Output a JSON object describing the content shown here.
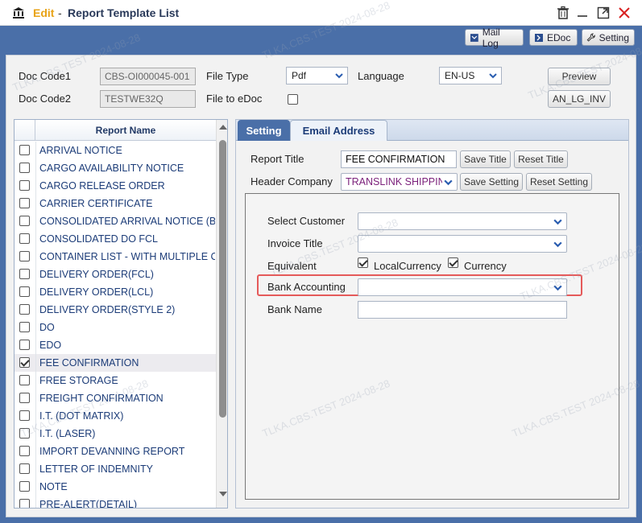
{
  "window": {
    "mode": "Edit",
    "separator": "-",
    "title": "Report Template List"
  },
  "toolbar": {
    "mail_log": "Mail Log",
    "edoc": "EDoc",
    "setting": "Setting"
  },
  "form": {
    "doc_code1_label": "Doc Code1",
    "doc_code1_value": "CBS-OI000045-001",
    "doc_code2_label": "Doc Code2",
    "doc_code2_value": "TESTWE32Q",
    "file_type_label": "File Type",
    "file_type_value": "Pdf",
    "file_to_edoc_label": "File to eDoc",
    "language_label": "Language",
    "language_value": "EN-US",
    "preview_button": "Preview",
    "template_button": "AN_LG_INV"
  },
  "report_list": {
    "header": "Report Name",
    "items": [
      {
        "name": "ARRIVAL NOTICE",
        "checked": false
      },
      {
        "name": "CARGO AVAILABILITY NOTICE",
        "checked": false
      },
      {
        "name": "CARGO RELEASE ORDER",
        "checked": false
      },
      {
        "name": "CARRIER CERTIFICATE",
        "checked": false
      },
      {
        "name": "CONSOLIDATED ARRIVAL NOTICE (BIL",
        "checked": false
      },
      {
        "name": "CONSOLIDATED DO FCL",
        "checked": false
      },
      {
        "name": "CONTAINER LIST - WITH MULTIPLE CO",
        "checked": false
      },
      {
        "name": "DELIVERY ORDER(FCL)",
        "checked": false
      },
      {
        "name": "DELIVERY ORDER(LCL)",
        "checked": false
      },
      {
        "name": "DELIVERY ORDER(STYLE 2)",
        "checked": false
      },
      {
        "name": "DO",
        "checked": false
      },
      {
        "name": "EDO",
        "checked": false
      },
      {
        "name": "FEE CONFIRMATION",
        "checked": true
      },
      {
        "name": "FREE STORAGE",
        "checked": false
      },
      {
        "name": "FREIGHT CONFIRMATION",
        "checked": false
      },
      {
        "name": "I.T. (DOT MATRIX)",
        "checked": false
      },
      {
        "name": "I.T. (LASER)",
        "checked": false
      },
      {
        "name": "IMPORT DEVANNING REPORT",
        "checked": false
      },
      {
        "name": "LETTER OF INDEMNITY",
        "checked": false
      },
      {
        "name": "NOTE",
        "checked": false
      },
      {
        "name": "PRE-ALERT(DETAIL)",
        "checked": false
      }
    ]
  },
  "tabs": {
    "setting": "Setting",
    "email_address": "Email Address"
  },
  "setting": {
    "report_title_label": "Report Title",
    "report_title_value": "FEE CONFIRMATION",
    "save_title": "Save Title",
    "reset_title": "Reset Title",
    "header_company_label": "Header Company",
    "header_company_value": "TRANSLINK SHIPPIN",
    "save_setting": "Save Setting",
    "reset_setting": "Reset Setting",
    "select_customer_label": "Select Customer",
    "invoice_title_label": "Invoice Title",
    "equivalent_label": "Equivalent",
    "local_currency_label": "LocalCurrency",
    "currency_label": "Currency",
    "bank_accounting_label": "Bank Accounting",
    "bank_name_label": "Bank Name"
  },
  "watermark": "TLKA.CBS.TEST 2024-08-28",
  "colors": {
    "accent": "#4a6fa8",
    "edit": "#e8a317",
    "highlight": "#e55a5a",
    "link": "#1c3c78"
  }
}
